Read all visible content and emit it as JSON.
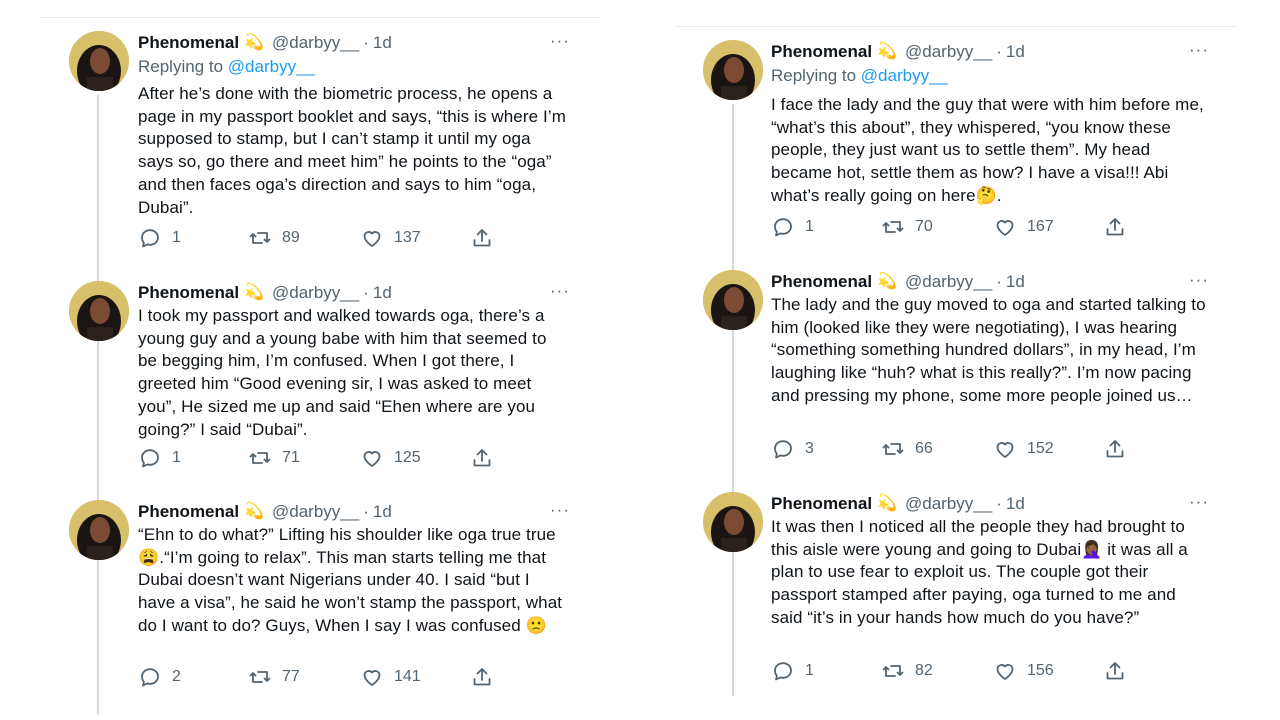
{
  "left": {
    "tweets": [
      {
        "name": "Phenomenal",
        "badge": "💫",
        "handle": "@darbyy__",
        "time": "1d",
        "more": "···",
        "replying_label": "Replying to",
        "replying_handle": "@darbyy__",
        "text": "After he’s done with the biometric process, he opens a page in my passport booklet and says, “this is where I’m supposed to stamp, but I can’t stamp it until my oga says so, go there and meet him” he points to the “oga” and then faces oga’s direction and says to him “oga, Dubai”.",
        "replies": "1",
        "retweets": "89",
        "likes": "137"
      },
      {
        "name": "Phenomenal",
        "badge": "💫",
        "handle": "@darbyy__",
        "time": "1d",
        "more": "···",
        "text": "I took my passport and walked towards oga, there’s a young guy and a young babe with him that seemed to be begging him, I’m confused. When I got there, I greeted him “Good evening sir, I was asked to meet you”, He sized me up and said “Ehen where are you going?” I said “Dubai”.",
        "replies": "1",
        "retweets": "71",
        "likes": "125"
      },
      {
        "name": "Phenomenal",
        "badge": "💫",
        "handle": "@darbyy__",
        "time": "1d",
        "more": "···",
        "text": "“Ehn to do what?” Lifting his shoulder like oga true true 😩.“I’m going to relax”. This man starts telling me that Dubai doesn’t want Nigerians under 40. I said “but I have a visa”, he said he won’t stamp the passport, what do I want to do? Guys, When I say I was confused 🙁",
        "replies": "2",
        "retweets": "77",
        "likes": "141"
      }
    ]
  },
  "right": {
    "tweets": [
      {
        "name": "Phenomenal",
        "badge": "💫",
        "handle": "@darbyy__",
        "time": "1d",
        "more": "···",
        "replying_label": "Replying to",
        "replying_handle": "@darbyy__",
        "text": "I face the lady and the guy that were with him before me, “what’s this about”, they whispered, “you know these people, they just want us to settle them”. My head became hot, settle them as how? I have a visa!!! Abi what’s really going on here🤔.",
        "replies": "1",
        "retweets": "70",
        "likes": "167"
      },
      {
        "name": "Phenomenal",
        "badge": "💫",
        "handle": "@darbyy__",
        "time": "1d",
        "more": "···",
        "text": "The lady and the guy moved to oga and started talking to him (looked like they were negotiating), I was hearing “something something hundred dollars”, in my head, I’m laughing like “huh? what is this really?”. I’m now pacing and pressing my phone, some more people joined us…",
        "replies": "3",
        "retweets": "66",
        "likes": "152"
      },
      {
        "name": "Phenomenal",
        "badge": "💫",
        "handle": "@darbyy__",
        "time": "1d",
        "more": "···",
        "text": "It was then I noticed all the people they had brought to this aisle were young and going to Dubai🤦🏾‍♀️ it was all a plan to use fear to exploit us. The couple got their passport stamped after paying, oga turned to me and said “it’s in your hands how much do you have?”",
        "replies": "1",
        "retweets": "82",
        "likes": "156"
      }
    ]
  },
  "icons": {
    "reply": "reply-icon",
    "retweet": "retweet-icon",
    "like": "heart-icon",
    "share": "share-icon",
    "more": "more-icon"
  },
  "colors": {
    "text": "#0f1419",
    "secondary": "#536471",
    "link": "#1d9bf0",
    "thread_line": "#cfd9de"
  }
}
